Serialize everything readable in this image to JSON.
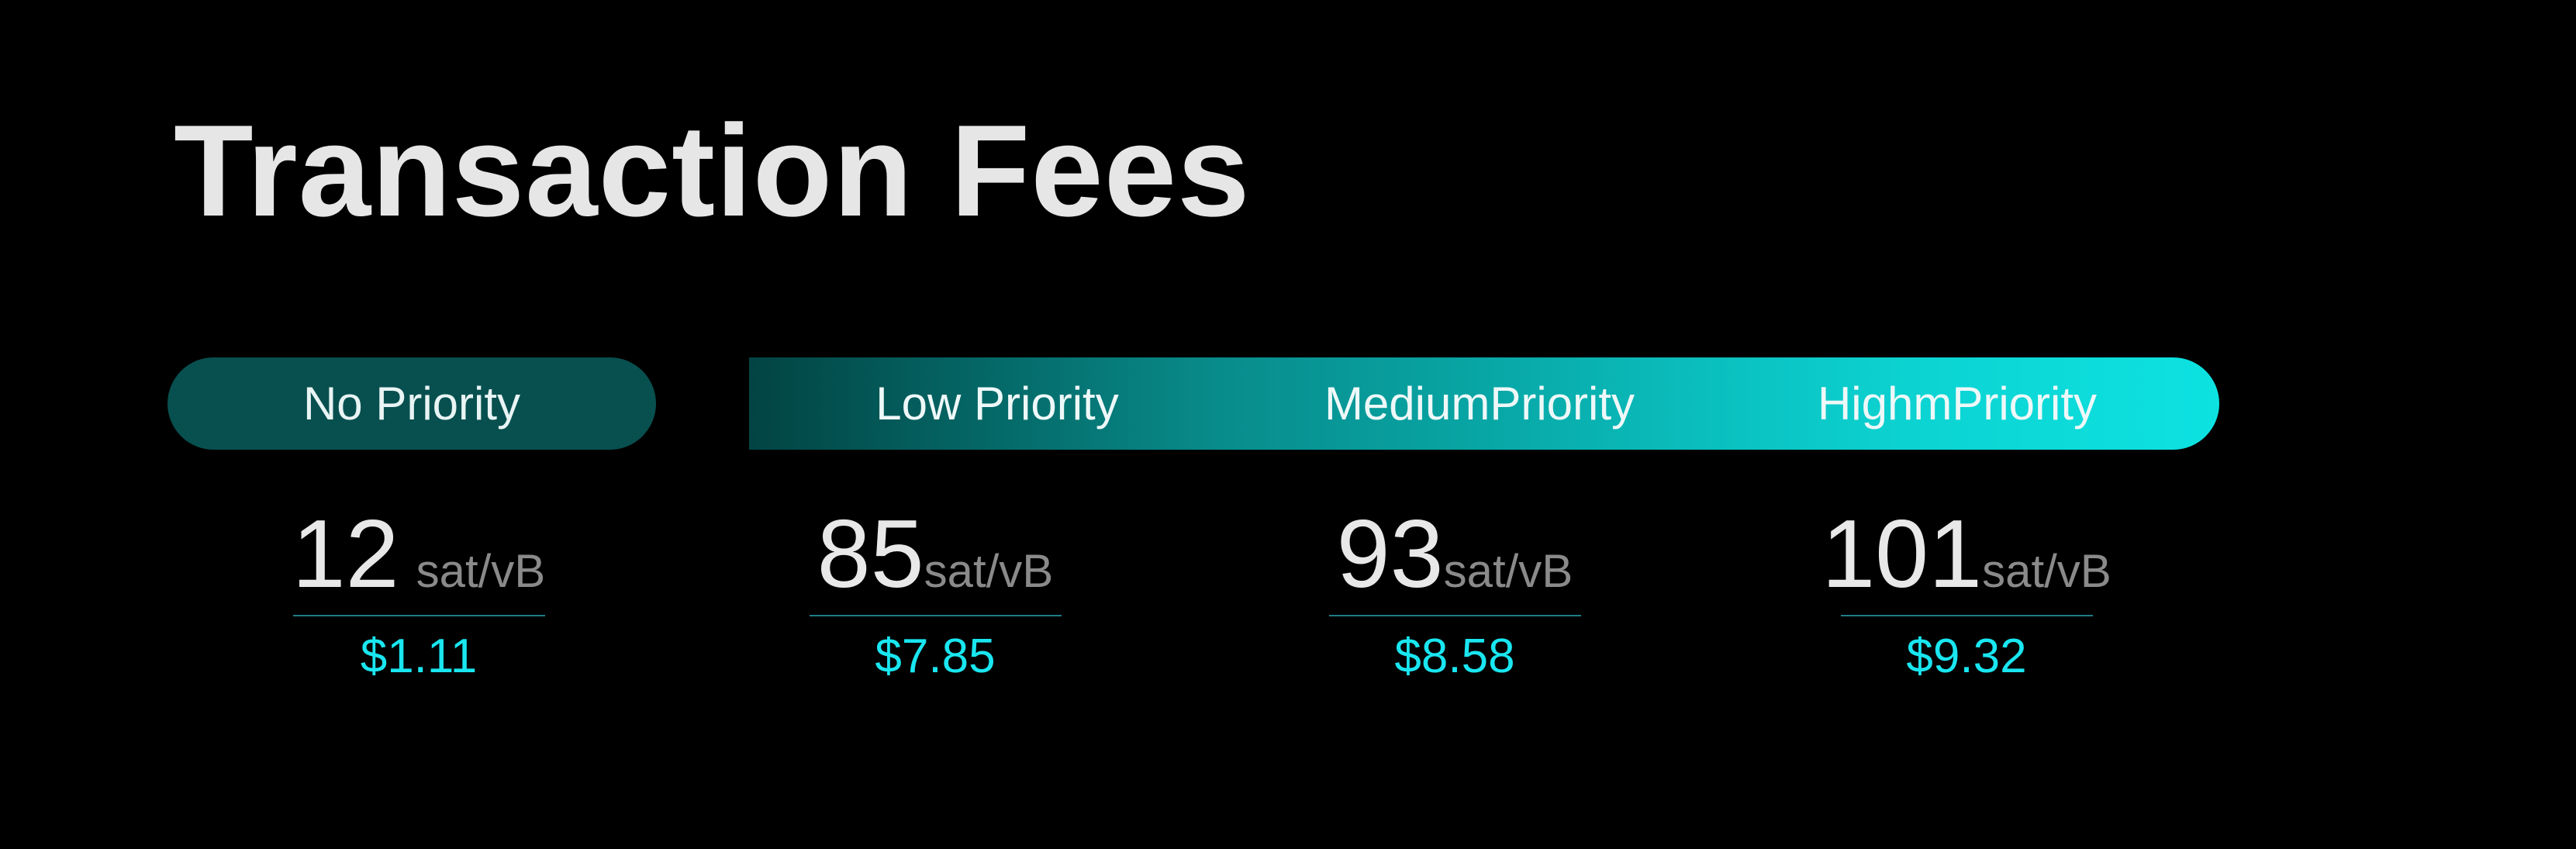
{
  "title": "Transaction Fees",
  "tiers": [
    {
      "label": "No Priority",
      "rate": "12",
      "unit": "sat/vB",
      "usd": "$1.11"
    },
    {
      "label": "Low Priority",
      "rate": "85",
      "unit": "sat/vB",
      "usd": "$7.85"
    },
    {
      "label": "MediumPriority",
      "rate": "93",
      "unit": "sat/vB",
      "usd": "$8.58"
    },
    {
      "label": "HighmPriority",
      "rate": "101",
      "unit": "sat/vB",
      "usd": "$9.32"
    }
  ],
  "colors": {
    "background": "#000000",
    "title": "#e6e6e6",
    "pill_no_priority": "#08504f",
    "gradient_start": "#024443",
    "gradient_end": "#0de2e1",
    "rate_number": "#e8e8e8",
    "rate_unit": "#8a8a8a",
    "usd_value": "#19e6f0",
    "divider": "#1c7d86"
  }
}
